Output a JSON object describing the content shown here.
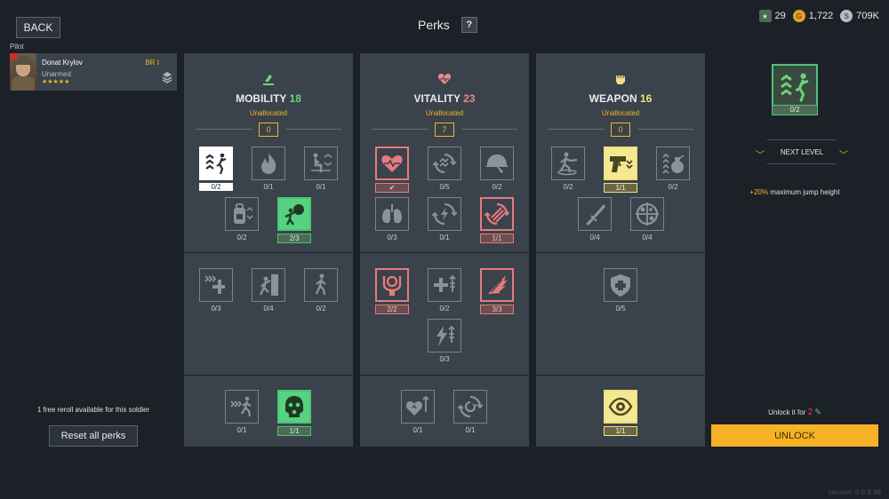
{
  "header": {
    "back_label": "BACK",
    "title": "Perks",
    "help_label": "?"
  },
  "currencies": [
    {
      "icon": "scroll-icon",
      "value": "29",
      "color": "#6ec27a"
    },
    {
      "icon": "gold-coin-icon",
      "value": "1,722",
      "color": "#e0a12a"
    },
    {
      "icon": "silver-coin-icon",
      "value": "709K",
      "color": "#b6bcc2"
    }
  ],
  "pilot": {
    "label": "Pilot",
    "name": "Donat Krylov",
    "equipment": "Unarmed",
    "stars": "★★★★★",
    "br": "BR I"
  },
  "sidebar": {
    "reroll_text": "1 free reroll available for this soldier",
    "reset_label": "Reset all perks"
  },
  "columns": [
    {
      "name": "MOBILITY",
      "points": "18",
      "color": "#6ed27e",
      "unallocated_label": "Unallocated",
      "unallocated": "0"
    },
    {
      "name": "VITALITY",
      "points": "23",
      "color": "#e88888",
      "unallocated_label": "Unallocated",
      "unallocated": "7"
    },
    {
      "name": "WEAPON",
      "points": "16",
      "color": "#f0e080",
      "unallocated_label": "Unallocated",
      "unallocated": "0"
    }
  ],
  "perks": {
    "mobility": [
      {
        "icon": "jump-height-icon",
        "count": "0/2",
        "state": "selected"
      },
      {
        "icon": "fire-icon",
        "count": "0/1",
        "state": "normal"
      },
      {
        "icon": "crouch-icon",
        "count": "0/1",
        "state": "normal"
      },
      {
        "icon": "backpack-icon",
        "count": "0/2",
        "state": "normal"
      },
      {
        "icon": "throw-icon",
        "count": "2/3",
        "state": "green"
      },
      {
        "icon": "sprint-heal-icon",
        "count": "0/3",
        "state": "normal"
      },
      {
        "icon": "climb-icon",
        "count": "0/4",
        "state": "normal"
      },
      {
        "icon": "walk-icon",
        "count": "0/2",
        "state": "normal"
      },
      {
        "icon": "fast-run-icon",
        "count": "0/1",
        "state": "normal"
      },
      {
        "icon": "gas-mask-icon",
        "count": "1/1",
        "state": "green"
      }
    ],
    "vitality": [
      {
        "icon": "heart-monitor-icon",
        "count": "✔",
        "state": "red"
      },
      {
        "icon": "stamina-cycle-icon",
        "count": "0/5",
        "state": "normal"
      },
      {
        "icon": "helmet-icon",
        "count": "0/2",
        "state": "normal"
      },
      {
        "icon": "lungs-icon",
        "count": "0/3",
        "state": "normal"
      },
      {
        "icon": "energy-regen-icon",
        "count": "0/1",
        "state": "normal"
      },
      {
        "icon": "stamina-regen-icon",
        "count": "1/1",
        "state": "red"
      },
      {
        "icon": "endurance-icon",
        "count": "2/2",
        "state": "red"
      },
      {
        "icon": "health-boost-icon",
        "count": "0/2",
        "state": "normal"
      },
      {
        "icon": "wings-icon",
        "count": "3/3",
        "state": "red"
      },
      {
        "icon": "energy-boost-icon",
        "count": "0/3",
        "state": "normal"
      },
      {
        "icon": "heart-boost-icon",
        "count": "0/1",
        "state": "normal"
      },
      {
        "icon": "recovery-cycle-icon",
        "count": "0/1",
        "state": "normal"
      }
    ],
    "weapon": [
      {
        "icon": "melee-dash-icon",
        "count": "0/2",
        "state": "normal"
      },
      {
        "icon": "pistol-icon",
        "count": "1/1",
        "state": "yellow"
      },
      {
        "icon": "grenade-icon",
        "count": "0/2",
        "state": "normal"
      },
      {
        "icon": "knife-icon",
        "count": "0/4",
        "state": "normal"
      },
      {
        "icon": "crosshair-icon",
        "count": "0/4",
        "state": "normal"
      },
      {
        "icon": "shield-icon",
        "count": "0/5",
        "state": "normal"
      },
      {
        "icon": "eye-icon",
        "count": "1/1",
        "state": "yellow"
      }
    ]
  },
  "detail": {
    "icon": "jump-height-icon",
    "count": "0/2",
    "next_level_label": "NEXT LEVEL",
    "desc_highlight": "+20%",
    "desc_rest": " maximum jump height",
    "unlock_for_label": "Unlock it for",
    "unlock_price": "2",
    "unlock_label": "UNLOCK"
  },
  "version": "version: 0.6.9.98"
}
